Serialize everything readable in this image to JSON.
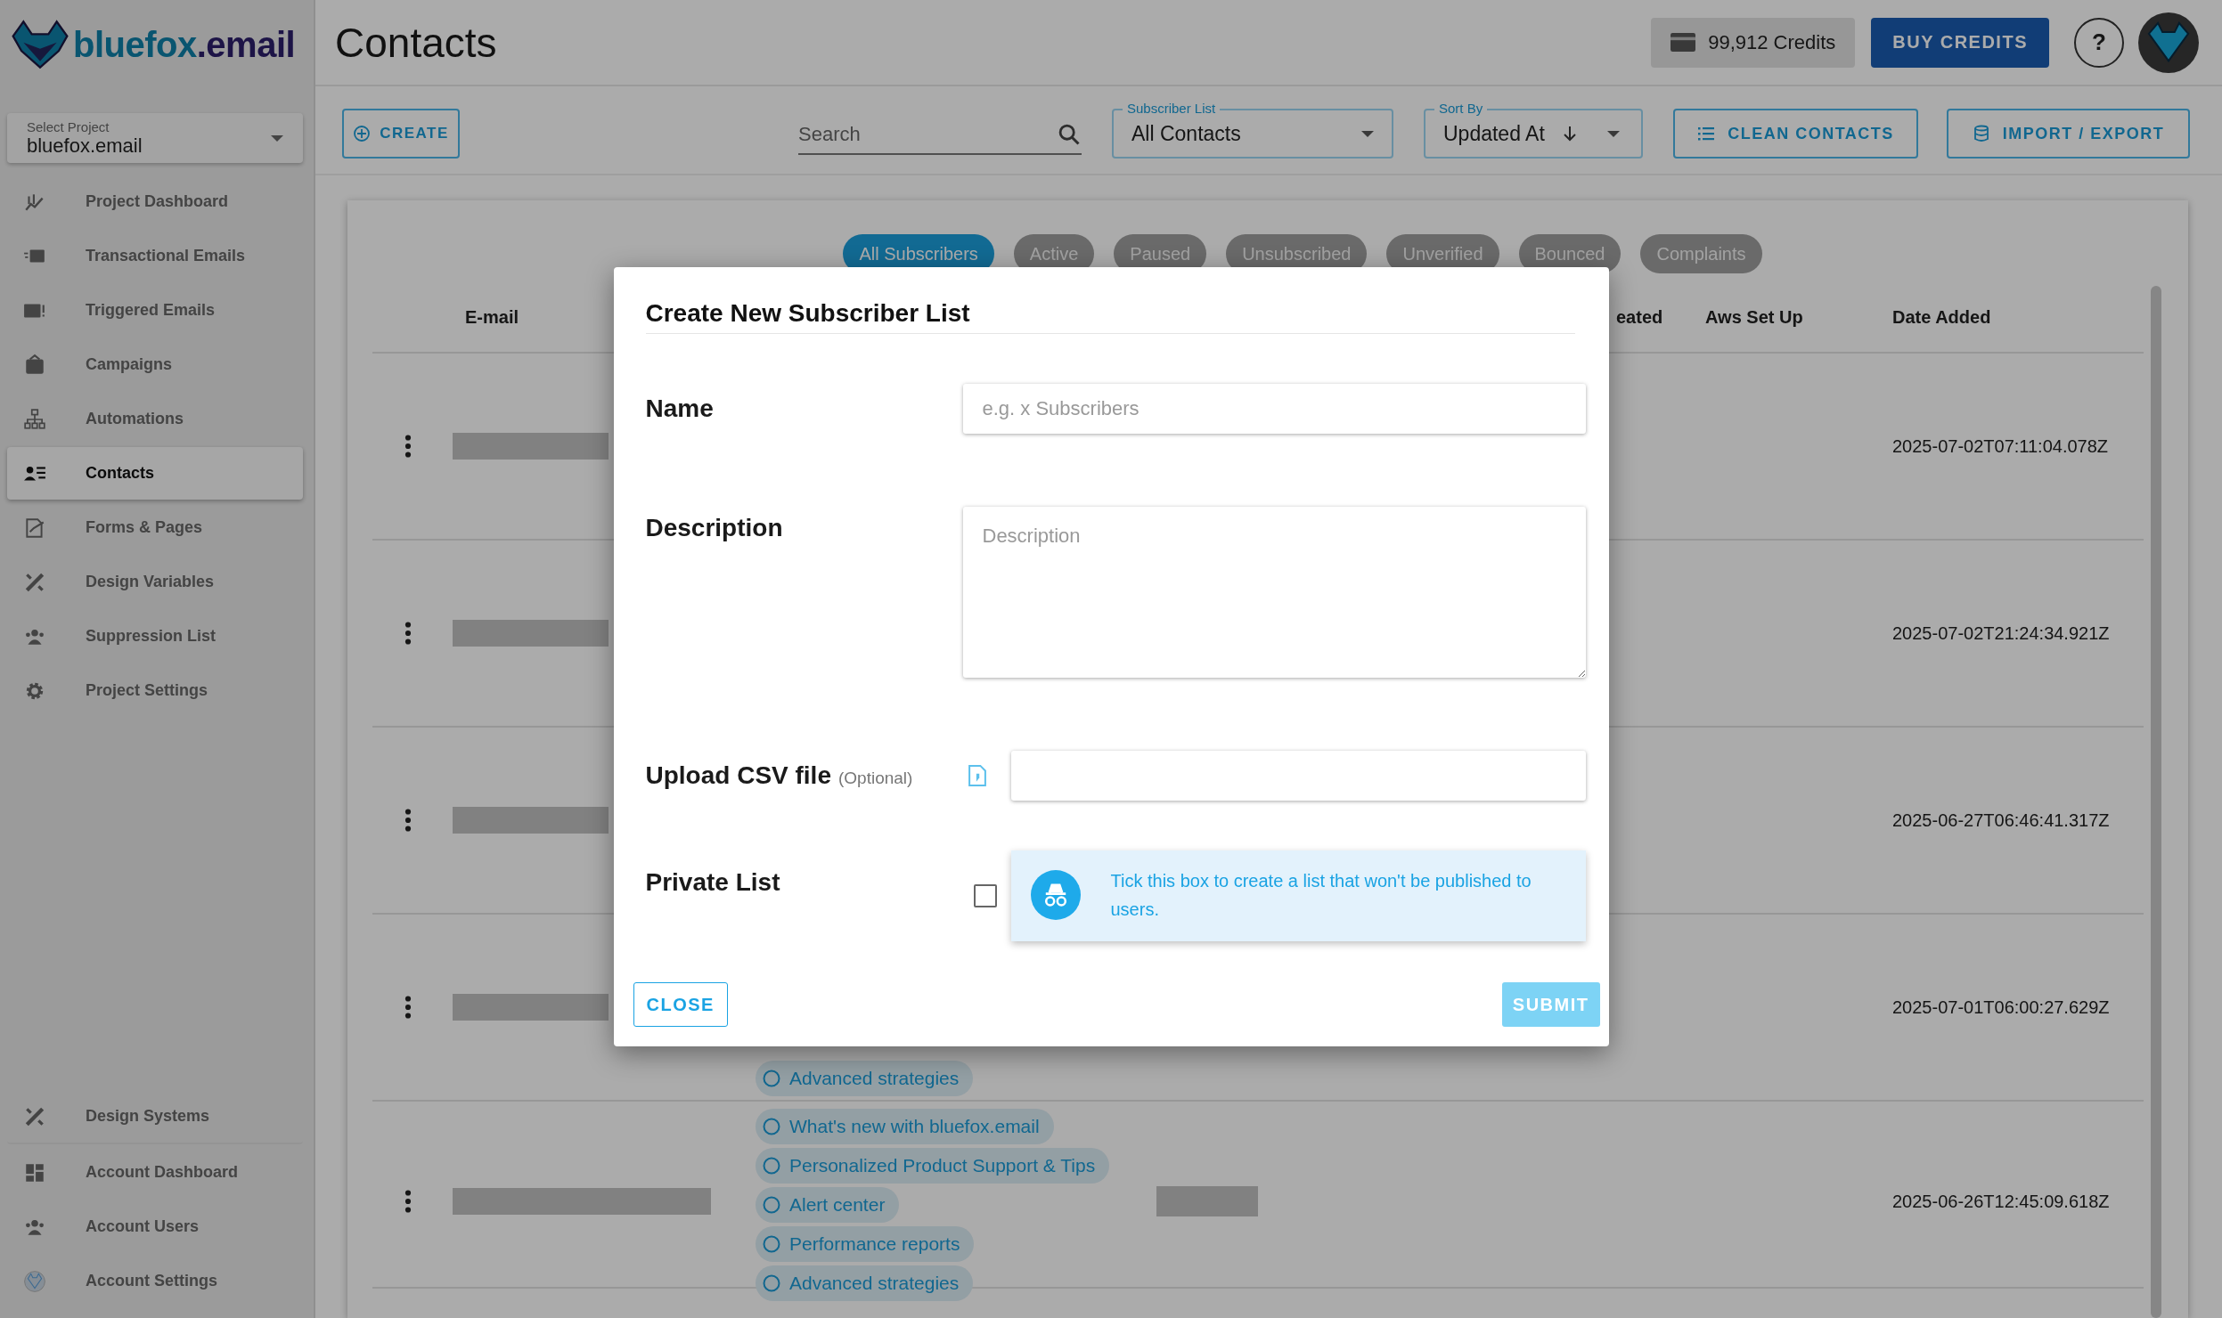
{
  "logo": {
    "name_part": "bluefox",
    "domain_part": ".email"
  },
  "project_select": {
    "label": "Select Project",
    "value": "bluefox.email"
  },
  "sidebar": {
    "items": [
      {
        "label": "Project Dashboard",
        "selected": false
      },
      {
        "label": "Transactional Emails",
        "selected": false
      },
      {
        "label": "Triggered Emails",
        "selected": false
      },
      {
        "label": "Campaigns",
        "selected": false
      },
      {
        "label": "Automations",
        "selected": false
      },
      {
        "label": "Contacts",
        "selected": true
      },
      {
        "label": "Forms & Pages",
        "selected": false
      },
      {
        "label": "Design Variables",
        "selected": false
      },
      {
        "label": "Suppression List",
        "selected": false
      },
      {
        "label": "Project Settings",
        "selected": false
      }
    ],
    "bottom_items": [
      {
        "label": "Design Systems",
        "selected": false
      },
      {
        "label": "Account Dashboard",
        "selected": false
      },
      {
        "label": "Account Users",
        "selected": false
      },
      {
        "label": "Account Settings",
        "selected": false
      }
    ]
  },
  "header": {
    "title": "Contacts",
    "credits": "99,912 Credits",
    "buy_button": "BUY CREDITS",
    "help": "?"
  },
  "toolbar": {
    "create": "CREATE",
    "search": {
      "placeholder": "Search"
    },
    "subscriber_list": {
      "label": "Subscriber List",
      "value": "All Contacts"
    },
    "sort_by": {
      "label": "Sort By",
      "value": "Updated At"
    },
    "clean": "CLEAN CONTACTS",
    "import_export": "IMPORT / EXPORT"
  },
  "filters": [
    {
      "label": "All Subscribers",
      "selected": true
    },
    {
      "label": "Active",
      "selected": false
    },
    {
      "label": "Paused",
      "selected": false
    },
    {
      "label": "Unsubscribed",
      "selected": false
    },
    {
      "label": "Unverified",
      "selected": false
    },
    {
      "label": "Bounced",
      "selected": false
    },
    {
      "label": "Complaints",
      "selected": false
    }
  ],
  "table": {
    "columns": {
      "email": "E-mail",
      "created": "eated",
      "aws": "Aws Set Up",
      "date_added": "Date Added"
    },
    "rows": [
      {
        "date_added": "2025-07-02T07:11:04.078Z",
        "lists": []
      },
      {
        "date_added": "2025-07-02T21:24:34.921Z",
        "lists": []
      },
      {
        "date_added": "2025-06-27T06:46:41.317Z",
        "lists": []
      },
      {
        "date_added": "2025-07-01T06:00:27.629Z",
        "lists": [
          "Advanced strategies"
        ]
      },
      {
        "date_added": "2025-06-26T12:45:09.618Z",
        "lists": [
          "What's new with bluefox.email",
          "Personalized Product Support & Tips",
          "Alert center",
          "Performance reports",
          "Advanced strategies"
        ]
      }
    ]
  },
  "dialog": {
    "title": "Create New Subscriber List",
    "fields": [
      {
        "kind": "text",
        "label": "Name",
        "placeholder": "e.g. x Subscribers"
      },
      {
        "kind": "textarea",
        "label": "Description",
        "placeholder": "Description"
      },
      {
        "kind": "file",
        "label": "Upload CSV file",
        "note": "(Optional)"
      },
      {
        "kind": "checkbox",
        "label": "Private List",
        "checked": false,
        "hint": "Tick this box to create a list that won't be published to users."
      }
    ],
    "close": "CLOSE",
    "submit": {
      "label": "SUBMIT",
      "disabled": true
    }
  }
}
